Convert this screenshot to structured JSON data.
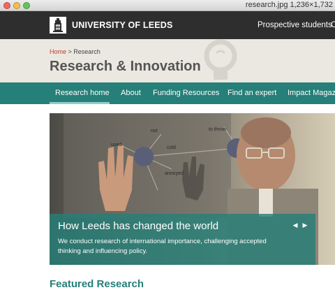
{
  "window": {
    "title": "research.jpg 1,236×1,732"
  },
  "header": {
    "logo_text": "UNIVERSITY OF LEEDS",
    "links": [
      "Prospective students",
      "C"
    ]
  },
  "breadcrumb": {
    "home": "Home",
    "separator": " > ",
    "current": "Research"
  },
  "page_title": "Research & Innovation",
  "nav": {
    "items": [
      "Research home",
      "About",
      "Funding Resources",
      "Find an expert",
      "Impact Magazine"
    ],
    "active_index": 0
  },
  "hero": {
    "headline": "How Leeds has changed the world",
    "description": "We conduct research of international importance, challenging accepted thinking and influencing policy.",
    "diagram_words": [
      "not",
      "to throw",
      "cold",
      "annoyed",
      "used"
    ],
    "prev_icon": "triangle-left-icon",
    "next_icon": "triangle-right-icon"
  },
  "featured": {
    "title": "Featured Research"
  },
  "colors": {
    "header_bg": "#2e2e2e",
    "title_band_bg": "#ebe8e1",
    "nav_bg": "#267f78",
    "accent": "#267f78",
    "breadcrumb_home": "#c0392b",
    "title_text": "#555555"
  }
}
